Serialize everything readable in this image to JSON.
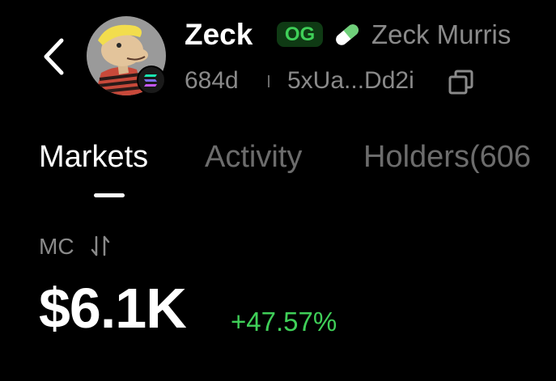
{
  "header": {
    "back_icon": "chevron-left-icon",
    "avatar_icon": "cartoon-avatar",
    "chain_icon": "solana-icon",
    "token_name": "Zeck",
    "og_badge": "OG",
    "creator_icon": "pill-icon",
    "creator_name": "Zeck Murris",
    "age": "684d",
    "address": "5xUa...Dd2i",
    "copy_icon": "copy-icon"
  },
  "tabs": [
    {
      "label": "Markets",
      "active": true
    },
    {
      "label": "Activity",
      "active": false
    },
    {
      "label": "Holders(606",
      "active": false
    }
  ],
  "market": {
    "label": "MC",
    "sort_icon": "sort-arrows-icon",
    "value": "$6.1K",
    "change": "+47.57%"
  },
  "colors": {
    "background": "#000000",
    "primary_text": "#ffffff",
    "muted_text": "#8a8a8a",
    "inactive_tab": "#6c6c6c",
    "positive": "#3fcf58",
    "og_badge_bg": "#0f3a14",
    "pill_green": "#6fd07a"
  }
}
